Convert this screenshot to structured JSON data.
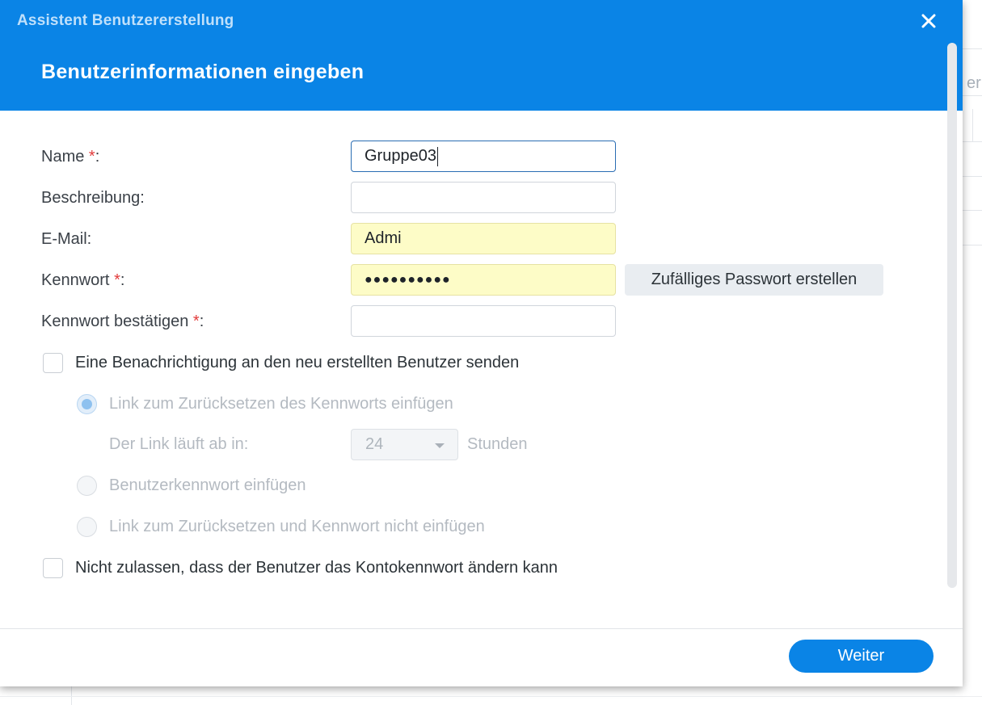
{
  "background": {
    "partial_text": "er"
  },
  "dialog": {
    "window_title": "Assistent Benutzererstellung",
    "step_title": "Benutzerinformationen eingeben",
    "fields": {
      "name": {
        "label": "Name ",
        "required_mark": "*",
        "suffix": ":",
        "value": "Gruppe03"
      },
      "description": {
        "label": "Beschreibung:",
        "value": ""
      },
      "email": {
        "label": "E-Mail:",
        "value": "Admi"
      },
      "password": {
        "label": "Kennwort ",
        "required_mark": "*",
        "suffix": ":",
        "masked_value": "●●●●●●●●●●"
      },
      "confirm_password": {
        "label": "Kennwort bestätigen ",
        "required_mark": "*",
        "suffix": ":",
        "value": ""
      }
    },
    "random_password_button": "Zufälliges Passwort erstellen",
    "notify_checkbox": {
      "label": "Eine Benachrichtigung an den neu erstellten Benutzer senden",
      "checked": false
    },
    "radio_options": [
      {
        "label": "Link zum Zurücksetzen des Kennworts einfügen",
        "selected": true
      },
      {
        "label": "Benutzerkennwort einfügen",
        "selected": false
      },
      {
        "label": "Link zum Zurücksetzen und Kennwort nicht einfügen",
        "selected": false
      }
    ],
    "link_expiry": {
      "label": "Der Link läuft ab in:",
      "value": "24",
      "unit": "Stunden"
    },
    "deny_change_checkbox": {
      "label": "Nicht zulassen, dass der Benutzer das Kontokennwort ändern kann",
      "checked": false
    },
    "next_button": "Weiter"
  },
  "colors": {
    "header_blue": "#0a84e6",
    "autofill_yellow": "#fdfcc7",
    "required_red": "#e23b3b"
  }
}
